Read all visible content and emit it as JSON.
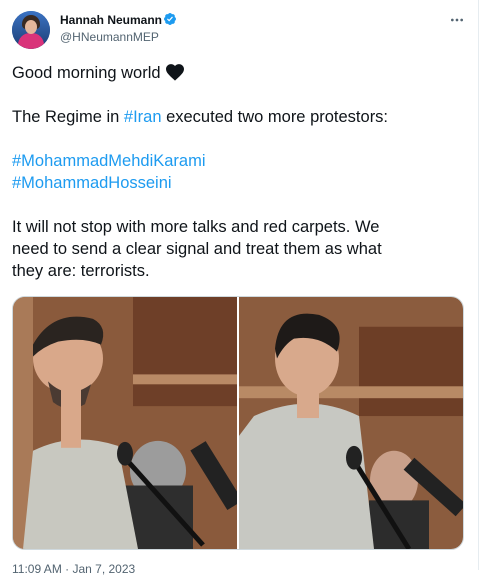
{
  "author": {
    "name": "Hannah Neumann",
    "handle": "@HNeumannMEP",
    "avatar_icon": "profile-avatar",
    "verified_icon": "verified-badge-icon",
    "verified_color": "#1d9bf0"
  },
  "menu_icon": "more-options-icon",
  "tweet": {
    "line1": "Good morning world",
    "line1_emoji": "black-heart-icon",
    "line2_prefix": "The Regime in ",
    "line2_hashtag": "#Iran",
    "line2_suffix": " executed two more protestors:",
    "hashtag1": "#MohammadMehdiKarami",
    "hashtag2": "#MohammadHosseini",
    "line5": "It will not stop with more talks and red carpets. We",
    "line6": "need to send a clear signal and treat them as what",
    "line7": "they are: terrorists."
  },
  "media": {
    "photos": [
      {
        "subject": "bearded man in grey shirt at courtroom microphone"
      },
      {
        "subject": "young man in grey shirt at courtroom microphone"
      }
    ]
  },
  "timestamp": "11:09 AM · Jan 7, 2023",
  "colors": {
    "link": "#1d9bf0",
    "muted": "#536471",
    "text": "#0f1419"
  }
}
